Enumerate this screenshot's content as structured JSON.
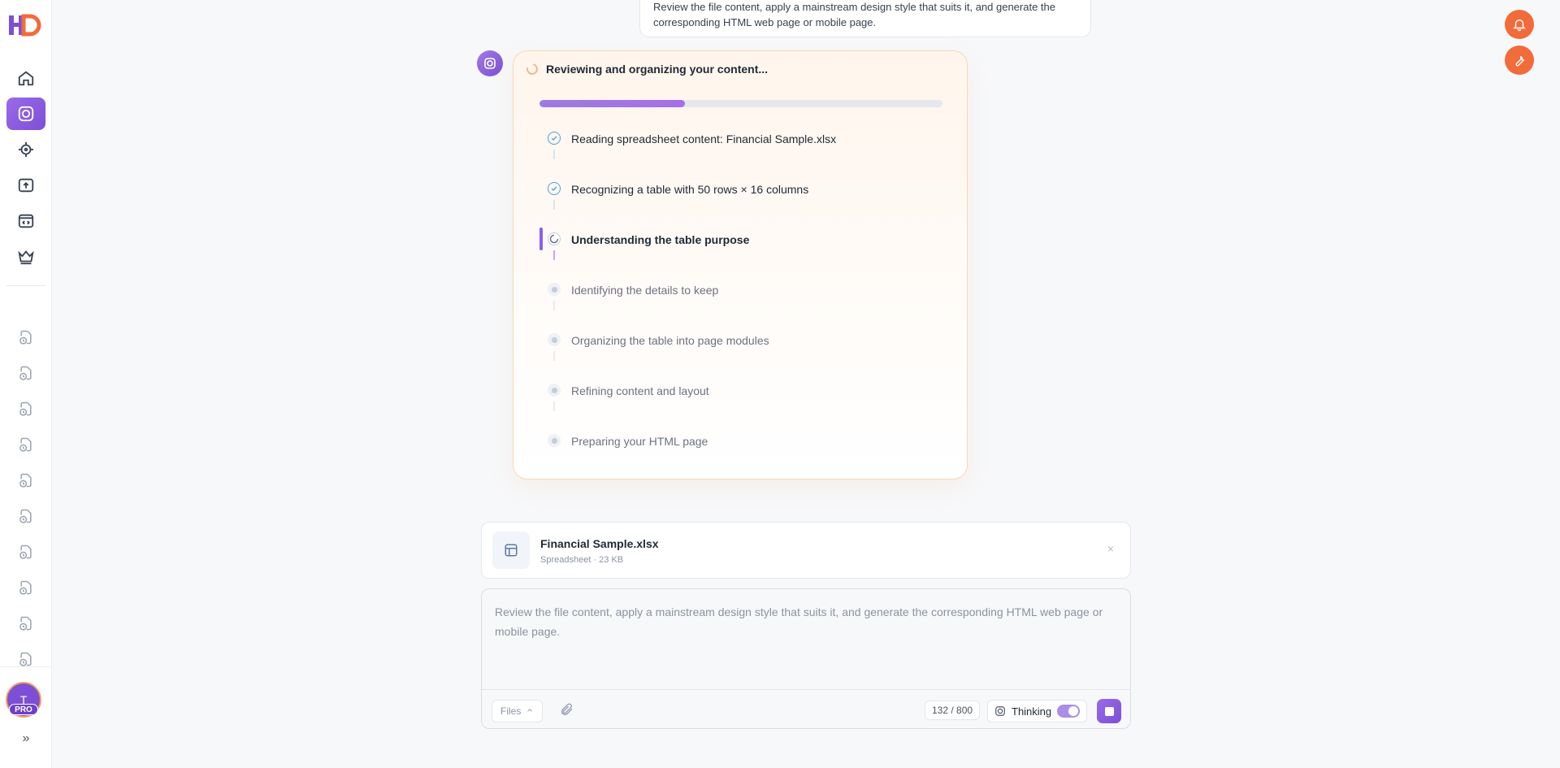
{
  "brand": {
    "logo_text": "HD",
    "accent": "#7c4fd6",
    "alert_color": "#f26b3a"
  },
  "sidebar": {
    "nav": [
      {
        "name": "home",
        "icon": "home-icon"
      },
      {
        "name": "create",
        "icon": "aperture-icon",
        "active": true
      },
      {
        "name": "explore",
        "icon": "target-icon"
      },
      {
        "name": "upload",
        "icon": "upload-icon"
      },
      {
        "name": "code",
        "icon": "code-window-icon"
      },
      {
        "name": "premium",
        "icon": "crown-icon"
      }
    ],
    "history_count": 10,
    "user": {
      "initial": "T",
      "badge": "PRO"
    },
    "expand_label": "»"
  },
  "conversation": {
    "user_message": "Review the file content, apply a mainstream design style that suits it, and generate the corresponding HTML web page or mobile page.",
    "progress": {
      "title": "Reviewing and organizing your content...",
      "fraction": 0.36,
      "steps": [
        {
          "label": "Reading spreadsheet content: Financial Sample.xlsx",
          "status": "done"
        },
        {
          "label": "Recognizing a table with 50 rows × 16 columns",
          "status": "done"
        },
        {
          "label": "Understanding the table purpose",
          "status": "active"
        },
        {
          "label": "Identifying the details to keep",
          "status": "pending"
        },
        {
          "label": "Organizing the table into page modules",
          "status": "pending"
        },
        {
          "label": "Refining content and layout",
          "status": "pending"
        },
        {
          "label": "Preparing your HTML page",
          "status": "pending"
        }
      ]
    }
  },
  "attachment": {
    "name": "Financial Sample.xlsx",
    "meta": "Spreadsheet · 23 KB",
    "close": "×"
  },
  "composer": {
    "text": "Review the file content, apply a mainstream design style that suits it, and generate the corresponding HTML web page or mobile page.",
    "files_label": "Files",
    "counter": "132 / 800",
    "thinking_label": "Thinking",
    "thinking_on": true
  }
}
